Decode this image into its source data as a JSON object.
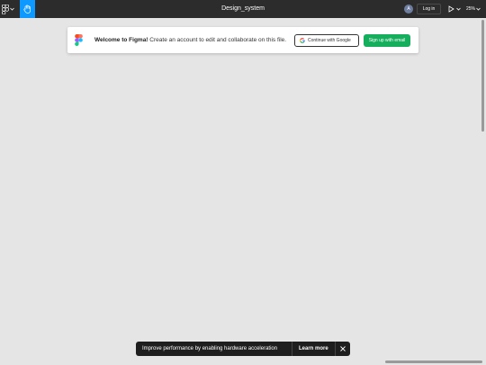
{
  "topbar": {
    "title": "Design_system",
    "avatar_initial": "A",
    "login_label": "Log in",
    "zoom_level": "25%",
    "icons": {
      "main_menu": "figma-logo-icon",
      "hand_tool": "hand-icon",
      "present": "play-icon",
      "dropdown": "chevron-down-icon"
    }
  },
  "banner": {
    "welcome_bold": "Welcome to Figma!",
    "welcome_text": "Create an account to edit and collaborate on this file.",
    "google_label": "Continue with Google",
    "signup_label": "Sign up with email",
    "icons": {
      "logo": "figma-logo-icon",
      "google": "google-icon"
    }
  },
  "toast": {
    "message": "Improve performance by enabling hardware acceleration",
    "learn_more": "Learn more",
    "close_icon": "close-icon"
  },
  "colors": {
    "topbar": "#2c2c2c",
    "canvas": "#e5e5e5",
    "accent_blue": "#0d99ff",
    "signup_green": "#14ae5c",
    "toast": "#1e1e1e"
  }
}
